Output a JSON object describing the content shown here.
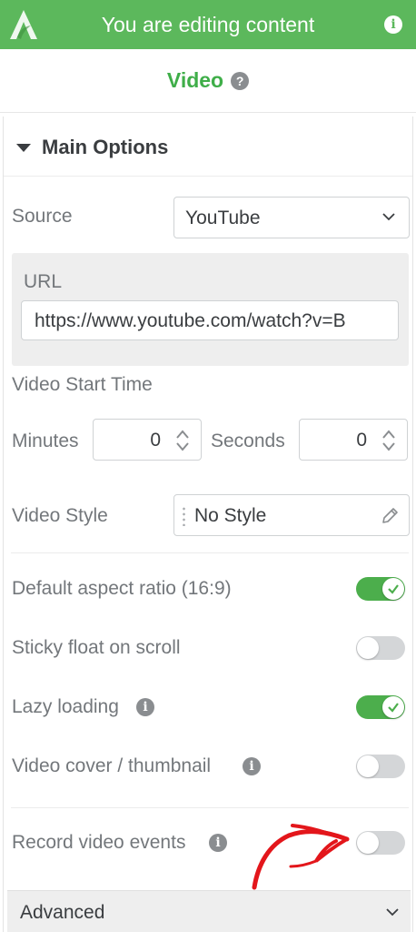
{
  "topbar": {
    "title": "You are editing content",
    "logo_icon": "logo-icon",
    "info_icon": "info-icon"
  },
  "header": {
    "title": "Video",
    "help_icon": "help-icon"
  },
  "main_options": {
    "title": "Main Options",
    "source": {
      "label": "Source",
      "value": "YouTube"
    },
    "url": {
      "label": "URL",
      "value": "https://www.youtube.com/watch?v=B"
    },
    "start_time": {
      "label": "Video Start Time",
      "minutes_label": "Minutes",
      "minutes_value": "0",
      "seconds_label": "Seconds",
      "seconds_value": "0"
    },
    "video_style": {
      "label": "Video Style",
      "value": "No Style"
    },
    "toggles": [
      {
        "label": "Default aspect ratio (16:9)",
        "on": true
      },
      {
        "label": "Sticky float on scroll",
        "on": false
      },
      {
        "label": "Lazy loading",
        "on": true
      },
      {
        "label": "Video cover / thumbnail",
        "on": false
      },
      {
        "label": "Record video events",
        "on": false
      }
    ]
  },
  "advanced": {
    "label": "Advanced"
  },
  "colors": {
    "brand_green": "#5cb85c",
    "title_green": "#3fae49",
    "toggle_on": "#4cae4c",
    "toggle_off": "#d4d6d8",
    "annotation_red": "#e3161b"
  }
}
